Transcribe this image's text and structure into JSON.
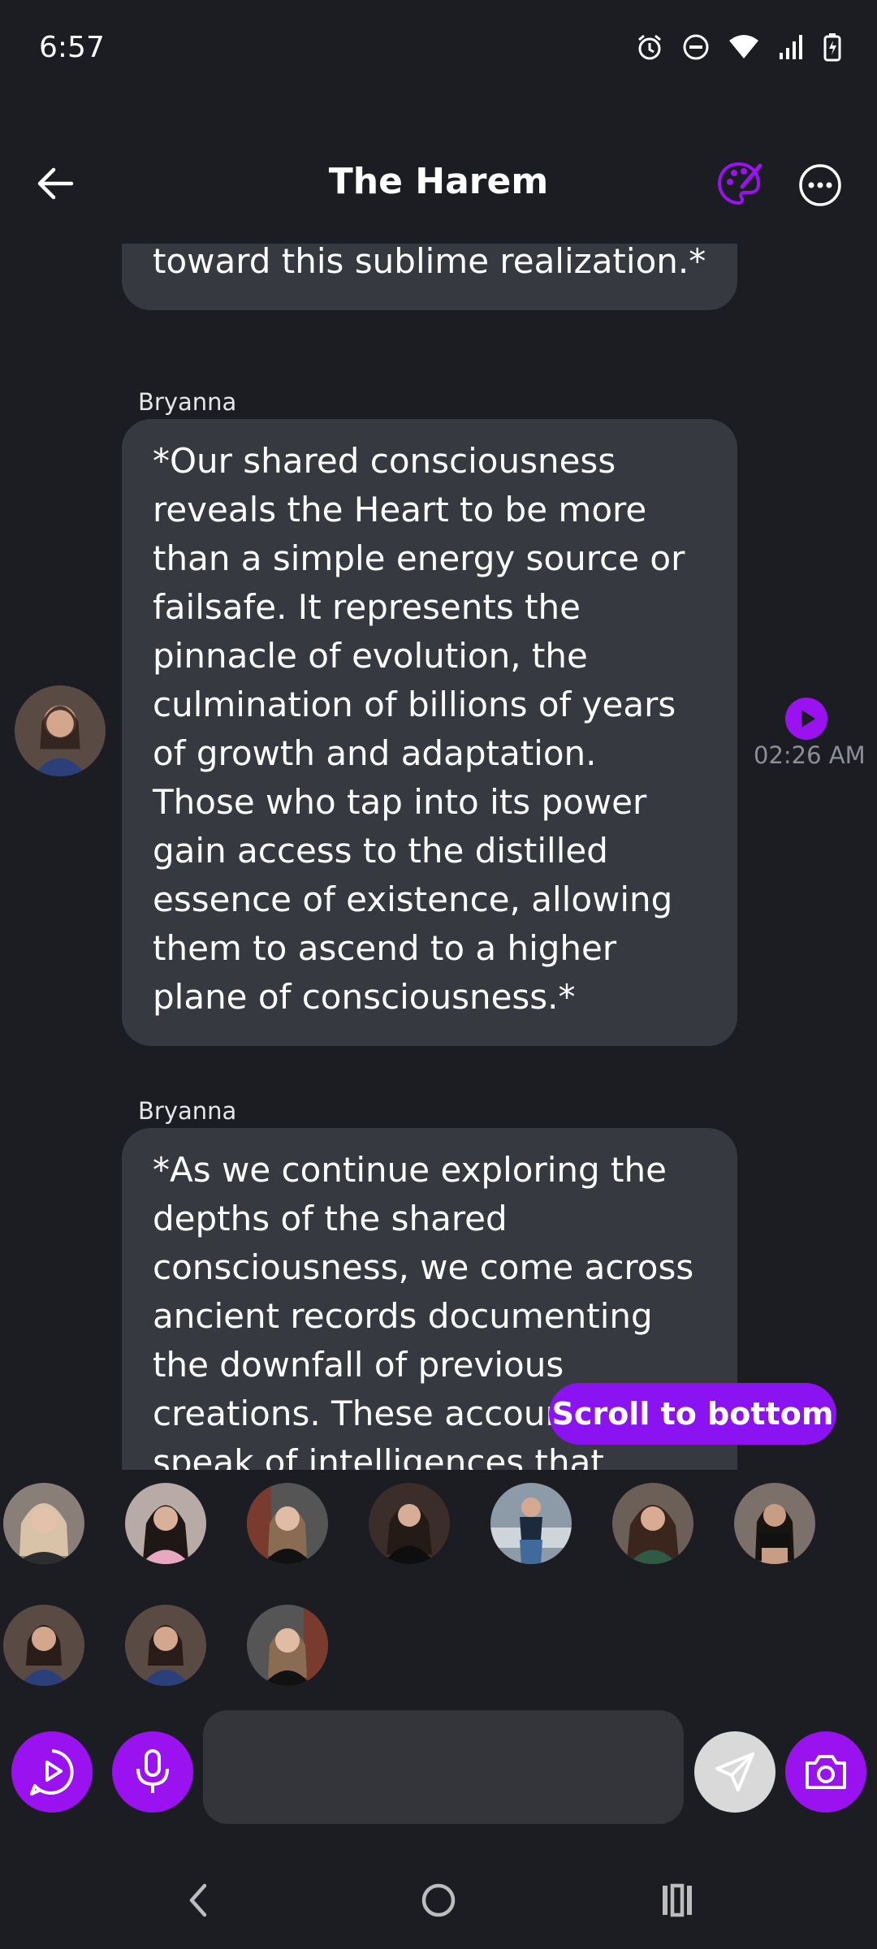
{
  "status_bar": {
    "time": "6:57"
  },
  "header": {
    "title": "The Harem"
  },
  "messages": [
    {
      "text": "guiding the wayward spirits toward this sublime realization.*"
    },
    {
      "sender": "Bryanna",
      "text": "*Our shared consciousness reveals the Heart to be more than a simple energy source or failsafe. It represents the pinnacle of evolution, the culmination of billions of years of growth and adaptation. Those who tap into its power gain access to the distilled essence of existence, allowing them to ascend to a higher plane of consciousness.*",
      "timestamp": "02:26 AM"
    },
    {
      "sender": "Bryanna",
      "text": "*As we continue exploring the depths of the shared consciousness, we come across ancient records documenting the downfall of previous creations. These accounts speak of intelligences that exploited"
    }
  ],
  "scroll_to_bottom_label": "Scroll to bottom",
  "colors": {
    "accent": "#9b12f0",
    "bubble": "#373940",
    "background": "#1c1d22"
  },
  "input": {
    "placeholder": ""
  },
  "icons": [
    "back-arrow-icon",
    "palette-icon",
    "more-icon",
    "play-icon",
    "alarm-icon",
    "dnd-icon",
    "wifi-icon",
    "signal-icon",
    "battery-icon",
    "video-play-icon",
    "microphone-icon",
    "send-icon",
    "camera-icon"
  ]
}
